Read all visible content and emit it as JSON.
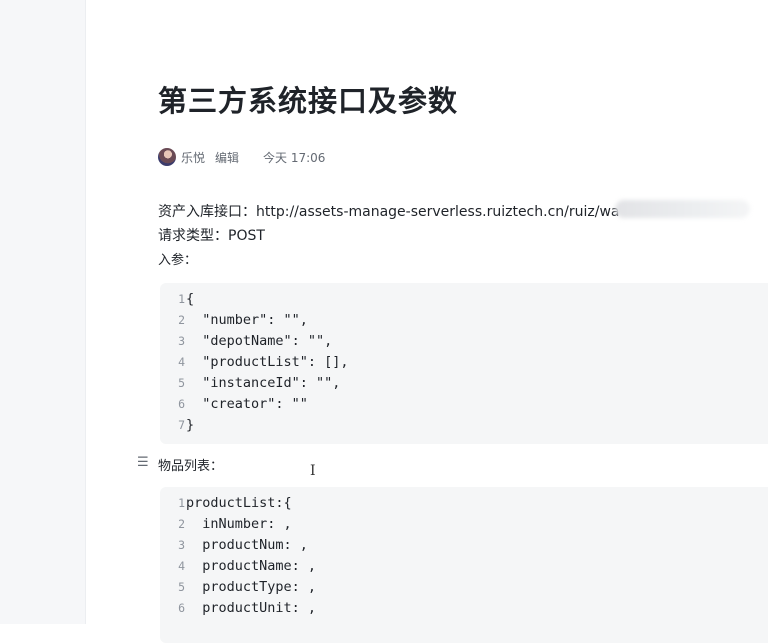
{
  "document": {
    "title": "第三方系统接口及参数",
    "author": "乐悦",
    "status": "编辑",
    "updated": "今天 17:06"
  },
  "content": {
    "api_line": "资产入库接口：http://assets-manage-serverless.ruiztech.cn/ruiz/wa",
    "request_type": "请求类型：POST",
    "params_label": "入参：",
    "code1": [
      {
        "n": "1",
        "text": "{"
      },
      {
        "n": "2",
        "text": "  \"number\": \"\","
      },
      {
        "n": "3",
        "text": "  \"depotName\": \"\","
      },
      {
        "n": "4",
        "text": "  \"productList\": [],"
      },
      {
        "n": "5",
        "text": "  \"instanceId\": \"\","
      },
      {
        "n": "6",
        "text": "  \"creator\": \"\""
      },
      {
        "n": "7",
        "text": "}"
      }
    ],
    "list_heading": "物品列表：",
    "code2": [
      {
        "n": "1",
        "text": "productList:{"
      },
      {
        "n": "2",
        "text": "  inNumber: ,"
      },
      {
        "n": "3",
        "text": "  productNum: ,"
      },
      {
        "n": "4",
        "text": "  productName: ,"
      },
      {
        "n": "5",
        "text": "  productType: ,"
      },
      {
        "n": "6",
        "text": "  productUnit: ,"
      }
    ]
  },
  "icons": {
    "list": "list-icon",
    "cursor": "text-cursor-icon"
  }
}
